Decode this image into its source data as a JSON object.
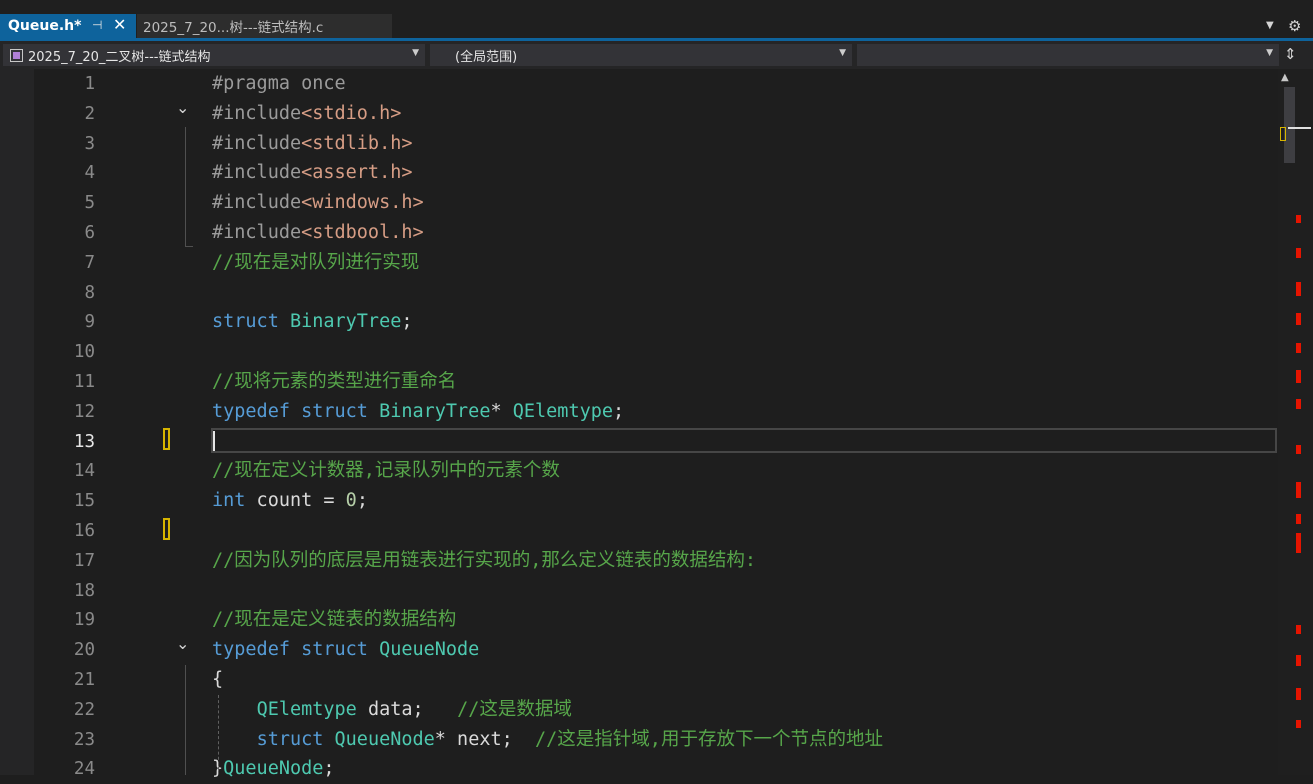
{
  "tabs": [
    {
      "label": "Queue.h*",
      "active": true
    },
    {
      "label": "2025_7_20...树---链式结构.c",
      "active": false
    }
  ],
  "tab_icons": {
    "pin": "pin-icon",
    "close": "close-icon",
    "overflow": "dropdown-icon",
    "settings": "gear-icon"
  },
  "navbar": {
    "project": "2025_7_20_二叉树---链式结构",
    "scope": "(全局范围)",
    "member": ""
  },
  "editor": {
    "current_line": 13,
    "lines": [
      {
        "n": "1",
        "parts": [
          [
            "pp",
            "#pragma once"
          ]
        ]
      },
      {
        "n": "2",
        "fold": true,
        "parts": [
          [
            "pp",
            "#include"
          ],
          [
            "inc",
            "<stdio.h>"
          ]
        ]
      },
      {
        "n": "3",
        "parts": [
          [
            "pp",
            "#include"
          ],
          [
            "inc",
            "<stdlib.h>"
          ]
        ]
      },
      {
        "n": "4",
        "parts": [
          [
            "pp",
            "#include"
          ],
          [
            "inc",
            "<assert.h>"
          ]
        ]
      },
      {
        "n": "5",
        "parts": [
          [
            "pp",
            "#include"
          ],
          [
            "inc",
            "<windows.h>"
          ]
        ]
      },
      {
        "n": "6",
        "parts": [
          [
            "pp",
            "#include"
          ],
          [
            "inc",
            "<stdbool.h>"
          ]
        ]
      },
      {
        "n": "7",
        "parts": [
          [
            "cm",
            "//现在是对队列进行实现"
          ]
        ]
      },
      {
        "n": "8",
        "parts": []
      },
      {
        "n": "9",
        "parts": [
          [
            "kw",
            "struct"
          ],
          [
            "id",
            " "
          ],
          [
            "ty",
            "BinaryTree"
          ],
          [
            "id",
            ";"
          ]
        ]
      },
      {
        "n": "10",
        "parts": []
      },
      {
        "n": "11",
        "parts": [
          [
            "cm",
            "//现将元素的类型进行重命名"
          ]
        ]
      },
      {
        "n": "12",
        "parts": [
          [
            "kw",
            "typedef"
          ],
          [
            "id",
            " "
          ],
          [
            "kw",
            "struct"
          ],
          [
            "id",
            " "
          ],
          [
            "ty",
            "BinaryTree"
          ],
          [
            "id",
            "* "
          ],
          [
            "ty",
            "QElemtype"
          ],
          [
            "id",
            ";"
          ]
        ]
      },
      {
        "n": "13",
        "parts": []
      },
      {
        "n": "14",
        "parts": [
          [
            "cm",
            "//现在定义计数器,记录队列中的元素个数"
          ]
        ]
      },
      {
        "n": "15",
        "parts": [
          [
            "kw",
            "int"
          ],
          [
            "id",
            " count = "
          ],
          [
            "nm",
            "0"
          ],
          [
            "id",
            ";"
          ]
        ]
      },
      {
        "n": "16",
        "parts": []
      },
      {
        "n": "17",
        "parts": [
          [
            "cm",
            "//因为队列的底层是用链表进行实现的,那么定义链表的数据结构:"
          ]
        ]
      },
      {
        "n": "18",
        "parts": []
      },
      {
        "n": "19",
        "parts": [
          [
            "cm",
            "//现在是定义链表的数据结构"
          ]
        ]
      },
      {
        "n": "20",
        "fold": true,
        "parts": [
          [
            "kw",
            "typedef"
          ],
          [
            "id",
            " "
          ],
          [
            "kw",
            "struct"
          ],
          [
            "id",
            " "
          ],
          [
            "ty",
            "QueueNode"
          ]
        ]
      },
      {
        "n": "21",
        "parts": [
          [
            "id",
            "{"
          ]
        ]
      },
      {
        "n": "22",
        "parts": [
          [
            "id",
            "    "
          ],
          [
            "ty",
            "QElemtype"
          ],
          [
            "id",
            " data;   "
          ],
          [
            "cm",
            "//这是数据域"
          ]
        ]
      },
      {
        "n": "23",
        "parts": [
          [
            "id",
            "    "
          ],
          [
            "kw",
            "struct"
          ],
          [
            "id",
            " "
          ],
          [
            "ty",
            "QueueNode"
          ],
          [
            "id",
            "* next;  "
          ],
          [
            "cm",
            "//这是指针域,用于存放下一个节点的地址"
          ]
        ]
      },
      {
        "n": "24",
        "parts": [
          [
            "id",
            "}"
          ],
          [
            "ty",
            "QueueNode"
          ],
          [
            "id",
            ";"
          ]
        ]
      }
    ]
  },
  "scrollbar": {
    "position": 0.0
  }
}
